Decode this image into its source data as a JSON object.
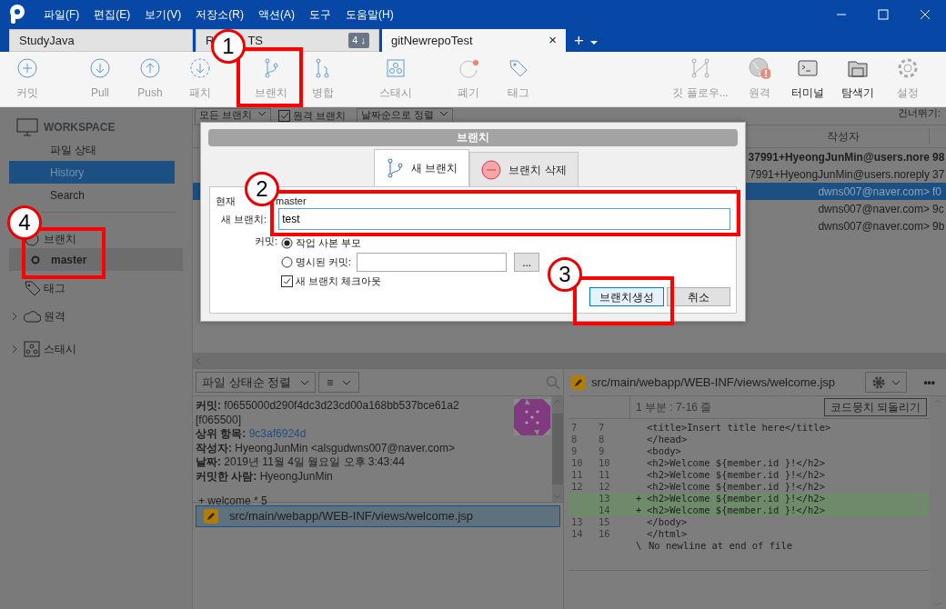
{
  "window": {
    "menu": [
      "파일(F)",
      "편집(E)",
      "보기(V)",
      "저장소(R)",
      "액션(A)",
      "도구",
      "도움말(H)"
    ]
  },
  "tabs": [
    {
      "label": "StudyJava",
      "selected": false
    },
    {
      "label_start": "R",
      "label_end": "TS",
      "badge": "4 ↓",
      "selected": false
    },
    {
      "label": "gitNewrepoTest",
      "selected": true,
      "close": "×"
    }
  ],
  "tab_actions": {
    "add": "+"
  },
  "toolbar": {
    "left": [
      {
        "label": "커밋",
        "emphasized": false
      },
      {
        "label": "Pull",
        "emphasized": false
      },
      {
        "label": "Push",
        "emphasized": false
      },
      {
        "label": "패치",
        "emphasized": false
      },
      {
        "label": "브랜치",
        "emphasized": false
      },
      {
        "label": "병합",
        "emphasized": false
      },
      {
        "label": "스태시",
        "emphasized": false
      },
      {
        "label": "폐기",
        "emphasized": false
      },
      {
        "label": "태그",
        "emphasized": false
      }
    ],
    "right": [
      {
        "label": "깃 플로우...",
        "emphasized": false
      },
      {
        "label": "원격",
        "emphasized": false
      },
      {
        "label": "터미널",
        "emphasized": true
      },
      {
        "label": "탐색기",
        "emphasized": true
      },
      {
        "label": "설정",
        "emphasized": false
      }
    ]
  },
  "sidebar": {
    "workspace": "WORKSPACE",
    "items": [
      {
        "label": "파일 상태",
        "selected": false
      },
      {
        "label": "History",
        "selected": true
      },
      {
        "label": "Search",
        "selected": false
      }
    ],
    "sections": [
      {
        "label": "브랜치",
        "children": [
          {
            "label": "master",
            "selected": true
          }
        ]
      },
      {
        "label": "태그"
      },
      {
        "label": "원격",
        "expanded": false
      },
      {
        "label": "스태시",
        "expanded": false
      }
    ]
  },
  "filter": {
    "branches": "모든 브랜치",
    "remote": {
      "label": "원격 브랜치",
      "checked": true
    },
    "sort": "날짜순으로 정렬",
    "skip": "건너뛰기:"
  },
  "table": {
    "columns": [
      "작성자"
    ],
    "rows": [
      {
        "author": "37991+HyeongJunMin@users.nore",
        "column_2": "98",
        "bold": true,
        "selected": false
      },
      {
        "author": "7991+HyeongJunMin@users.noreply",
        "column_2": "37",
        "bold": false,
        "selected": false
      },
      {
        "author": "dwns007@naver.com>",
        "column_2": "f0",
        "bold": false,
        "selected": true
      },
      {
        "author": "dwns007@naver.com>",
        "column_2": "9c",
        "bold": false,
        "selected": false
      },
      {
        "author": "dwns007@naver.com>",
        "column_2": "9b",
        "bold": false,
        "selected": false
      }
    ]
  },
  "details": {
    "sort": "파일 상태순 정렬",
    "view": "≡",
    "lines": [
      {
        "label": "커밋:",
        "value": "f0655000d290f4dc3d23cd00a168bb537bce61a2",
        "kind": "text"
      },
      {
        "value": "[f065500]",
        "kind": "text"
      },
      {
        "label": "상위 항목:",
        "value": "9c3af6924d",
        "kind": "link"
      },
      {
        "label": "작성자:",
        "value": "HyeongJunMin <alsgudwns007@naver.com>",
        "kind": "text"
      },
      {
        "label": "날짜:",
        "value": "2019년 11월 4일 월요일 오후 3:43:44",
        "kind": "text"
      },
      {
        "label": "커밋한 사람:",
        "value": "HyeongJunMin",
        "kind": "text"
      }
    ],
    "message": "+ welcome * 5"
  },
  "files": [
    {
      "path": "src/main/webapp/WEB-INF/views/welcome.jsp",
      "selected": true
    }
  ],
  "diff": {
    "path": "src/main/webapp/WEB-INF/views/welcome.jsp",
    "more": "•••",
    "hunk": "1 부분 : 7-16 줄",
    "revert": "코드뭉치 되돌리기",
    "lines": [
      {
        "old": "7",
        "new": "7",
        "text": "<title>Insert title here</title>",
        "kind": "context"
      },
      {
        "old": "8",
        "new": "8",
        "text": "</head>",
        "kind": "context"
      },
      {
        "old": "9",
        "new": "9",
        "text": "<body>",
        "kind": "context"
      },
      {
        "old": "10",
        "new": "10",
        "text": "<h2>Welcome ${member.id }!</h2>",
        "kind": "context"
      },
      {
        "old": "11",
        "new": "11",
        "text": "<h2>Welcome ${member.id }!</h2>",
        "kind": "context"
      },
      {
        "old": "12",
        "new": "12",
        "text": "<h2>Welcome ${member.id }!</h2>",
        "kind": "context"
      },
      {
        "new": "13",
        "marker": "+",
        "text": "<h2>Welcome ${member.id }!</h2>",
        "kind": "added"
      },
      {
        "new": "14",
        "marker": "+",
        "text": "<h2>Welcome ${member.id }!</h2>",
        "kind": "added"
      },
      {
        "old": "13",
        "new": "15",
        "text": "</body>",
        "kind": "context"
      },
      {
        "old": "14",
        "new": "16",
        "text": "</html>",
        "kind": "context"
      },
      {
        "marker": "\\",
        "text": "No newline at end of file",
        "kind": "note"
      }
    ]
  },
  "dialog": {
    "title": "브랜치",
    "tabs": [
      {
        "label": "새 브랜치",
        "selected": true
      },
      {
        "label": "브랜치 삭제",
        "selected": false
      }
    ],
    "current_label": "현재",
    "current_value": "master",
    "new_label": "새 브랜치:",
    "new_value": "test",
    "commit_label": "커밋:",
    "options": [
      {
        "label": "작업 사본 부모",
        "selected": true
      },
      {
        "label": "명시된 커밋:",
        "selected": false
      }
    ],
    "browse": "...",
    "checkout": {
      "label": "새 브랜치 체크아웃",
      "checked": true
    },
    "buttons": [
      {
        "label": "브랜치생성",
        "kind": "primary"
      },
      {
        "label": "취소",
        "kind": "default"
      }
    ]
  },
  "annotations": [
    {
      "number": "1"
    },
    {
      "number": "2"
    },
    {
      "number": "3"
    },
    {
      "number": "4"
    }
  ]
}
